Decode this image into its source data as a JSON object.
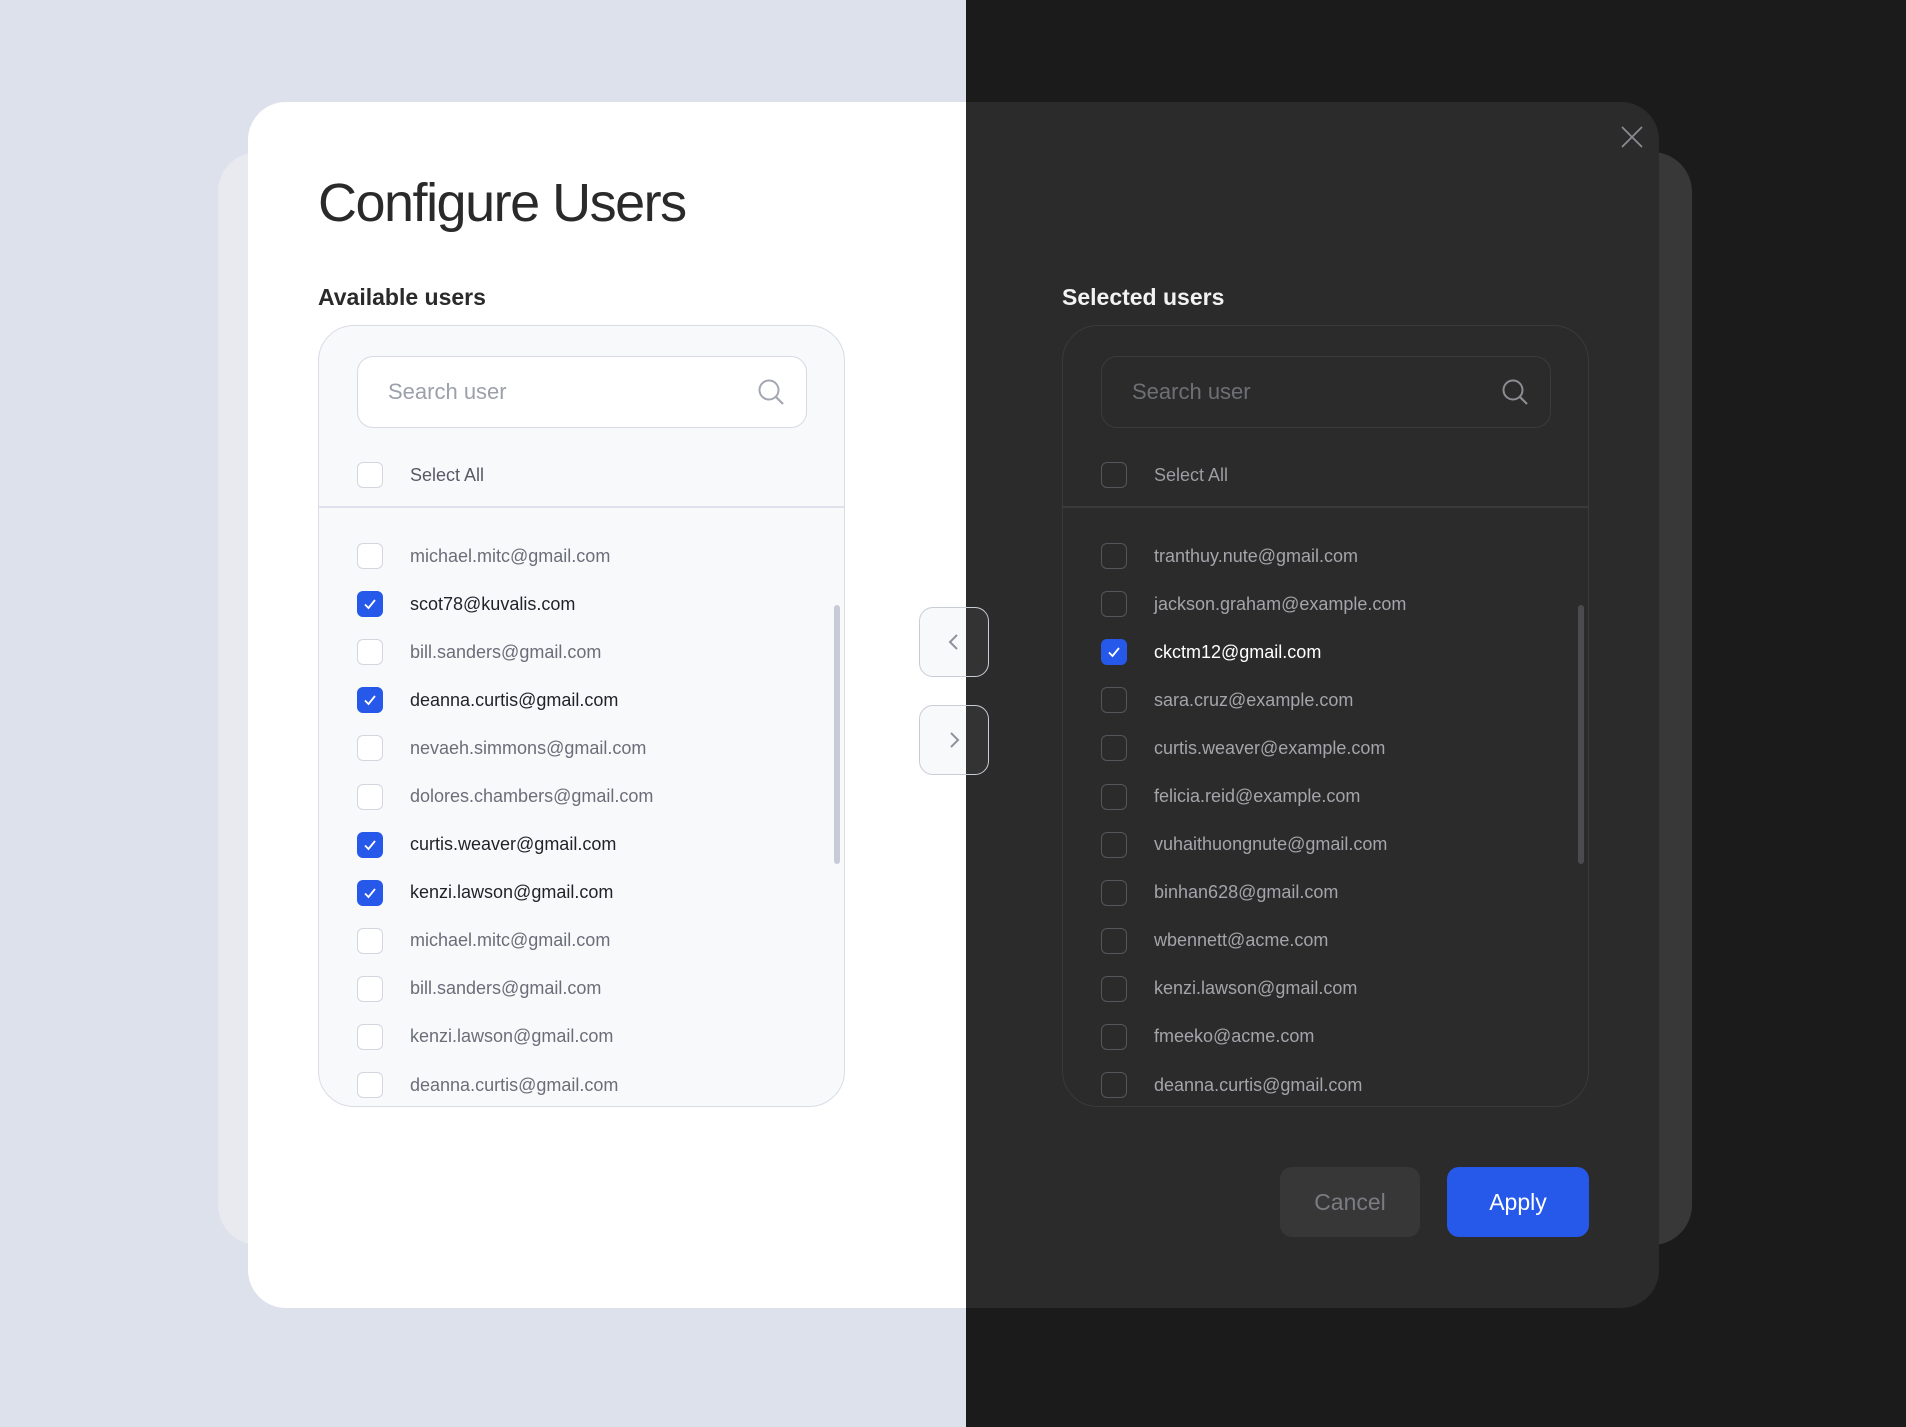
{
  "dialog": {
    "title": "Configure Users"
  },
  "available": {
    "heading": "Available users",
    "search_placeholder": "Search user",
    "select_all": "Select All",
    "users": [
      {
        "email": "michael.mitc@gmail.com",
        "checked": false
      },
      {
        "email": "scot78@kuvalis.com",
        "checked": true
      },
      {
        "email": "bill.sanders@gmail.com",
        "checked": false
      },
      {
        "email": "deanna.curtis@gmail.com",
        "checked": true
      },
      {
        "email": "nevaeh.simmons@gmail.com",
        "checked": false
      },
      {
        "email": "dolores.chambers@gmail.com",
        "checked": false
      },
      {
        "email": "curtis.weaver@gmail.com",
        "checked": true
      },
      {
        "email": "kenzi.lawson@gmail.com",
        "checked": true
      },
      {
        "email": "michael.mitc@gmail.com",
        "checked": false
      },
      {
        "email": "bill.sanders@gmail.com",
        "checked": false
      },
      {
        "email": "kenzi.lawson@gmail.com",
        "checked": false
      },
      {
        "email": "deanna.curtis@gmail.com",
        "checked": false
      }
    ]
  },
  "selected": {
    "heading": "Selected users",
    "search_placeholder": "Search user",
    "select_all": "Select All",
    "users": [
      {
        "email": "tranthuy.nute@gmail.com",
        "checked": false
      },
      {
        "email": "jackson.graham@example.com",
        "checked": false
      },
      {
        "email": "ckctm12@gmail.com",
        "checked": true
      },
      {
        "email": "sara.cruz@example.com",
        "checked": false
      },
      {
        "email": "curtis.weaver@example.com",
        "checked": false
      },
      {
        "email": "felicia.reid@example.com",
        "checked": false
      },
      {
        "email": "vuhaithuongnute@gmail.com",
        "checked": false
      },
      {
        "email": "binhan628@gmail.com",
        "checked": false
      },
      {
        "email": "wbennett@acme.com",
        "checked": false
      },
      {
        "email": "kenzi.lawson@gmail.com",
        "checked": false
      },
      {
        "email": "fmeeko@acme.com",
        "checked": false
      },
      {
        "email": "deanna.curtis@gmail.com",
        "checked": false
      }
    ]
  },
  "actions": {
    "cancel": "Cancel",
    "apply": "Apply"
  },
  "icons": {
    "close": "close-icon",
    "search": "search-icon",
    "move_left": "chevron-left-icon",
    "move_right": "chevron-right-icon",
    "check": "check-icon"
  },
  "colors": {
    "accent": "#2659ea",
    "light_bg": "#dde1ec",
    "dark_bg": "#1b1b1b"
  }
}
